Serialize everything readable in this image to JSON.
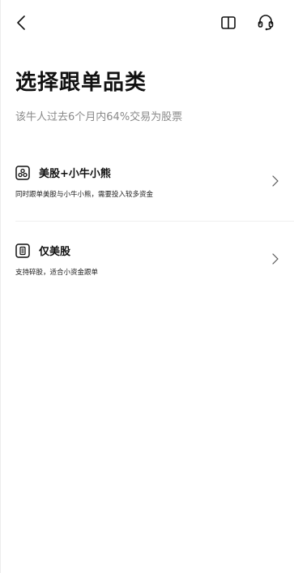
{
  "header": {
    "back_icon": "chevron-left-icon",
    "book_icon": "book-open-icon",
    "support_icon": "headset-icon"
  },
  "page": {
    "title": "选择跟单品类",
    "subtitle": "该牛人过去6个月内64%交易为股票"
  },
  "options": [
    {
      "icon": "stock-group-icon",
      "title": "美股+小牛小熊",
      "description": "同时跟单美股与小牛小熊，需要投入较多资金",
      "chevron_icon": "chevron-right-icon"
    },
    {
      "icon": "document-list-icon",
      "title": "仅美股",
      "description": "支持碎股，适合小资金跟单",
      "chevron_icon": "chevron-right-icon"
    }
  ],
  "colors": {
    "text_primary": "#111111",
    "text_secondary": "#8a8a8a",
    "divider": "#efefef",
    "background": "#ffffff"
  }
}
